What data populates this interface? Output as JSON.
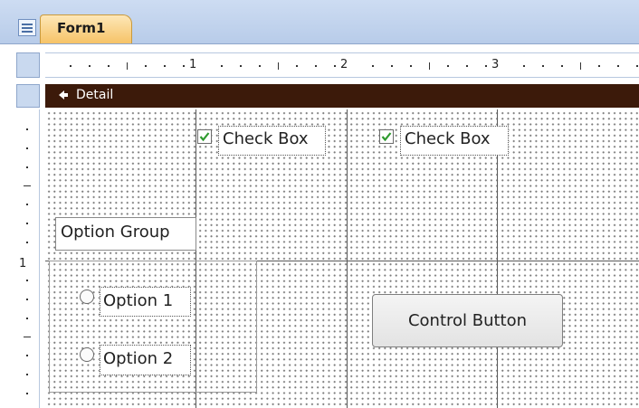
{
  "window": {
    "tab_title": "Form1"
  },
  "ruler": {
    "marks": [
      "1",
      "2",
      "3"
    ],
    "vertical_marks": [
      "1"
    ]
  },
  "detail": {
    "label": "Detail"
  },
  "controls": {
    "checkbox1": {
      "label": "Check Box",
      "checked": true
    },
    "checkbox2": {
      "label": "Check Box",
      "checked": true
    },
    "option_group_label": "Option Group",
    "option1": {
      "label": "Option 1"
    },
    "option2": {
      "label": "Option 2"
    },
    "control_button": "Control Button"
  },
  "colors": {
    "tab_accent": "#f6c367",
    "detail_bar": "#3c1a0a",
    "checkmark": "#2f9a2f",
    "ribbon": "#cddcf2"
  }
}
